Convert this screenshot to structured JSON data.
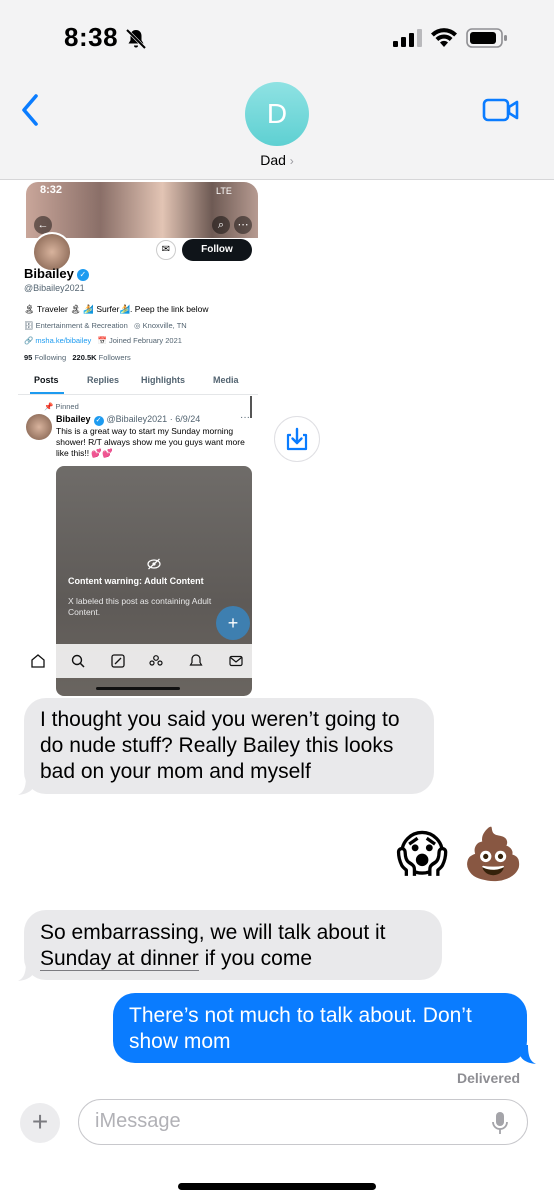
{
  "status_bar": {
    "time": "8:38",
    "icons": [
      "bell-slash-icon",
      "cellular-signal-icon",
      "wifi-icon",
      "battery-icon"
    ]
  },
  "nav": {
    "back_icon": "chevron-left-icon",
    "avatar_initial": "D",
    "contact_name": "Dad",
    "contact_chevron": "›",
    "video_icon": "video-camera-icon",
    "accent": "#0a7cff"
  },
  "shared_image": {
    "banner_time": "8:32",
    "banner_network": "LTE",
    "follow_label": "Follow",
    "name": "Bibailey",
    "handle": "@Bibailey2021",
    "bio": "🏝 Traveler 🏝 🏄 Surfer🏄. Peep the link below",
    "meta_category": "🗄 Entertainment & Recreation",
    "meta_location": "◎ Knoxville, TN",
    "meta_link": "🔗 msha.ke/bibailey",
    "meta_joined": "📅 Joined February 2021",
    "following_count": "95",
    "following_label": "Following",
    "followers_count": "220.5K",
    "followers_label": "Followers",
    "tabs": [
      "Posts",
      "Replies",
      "Highlights",
      "Media"
    ],
    "pinned_label": "📌 Pinned",
    "tweet_name": "Bibailey",
    "tweet_handle_date": "@Bibailey2021 · 6/9/24",
    "tweet_more": "···",
    "tweet_text": "This is a great way to start my Sunday morning shower! R/T always show me you guys want more like this!! 💕💕",
    "content_warning_title": "Content warning: Adult Content",
    "content_warning_desc": "X labeled this post as containing Adult Content.",
    "fab_label": "+"
  },
  "save_button_icon": "download-icon",
  "messages": {
    "received_1": "I thought you said you weren’t going to do nude stuff? Really Bailey this looks bad on your mom and myself",
    "sent_emojis": "😱 💩",
    "received_2_prefix": "So embarrassing, we will talk about it ",
    "received_2_link": "Sunday at dinner",
    "received_2_suffix": " if you come",
    "sent_1": "There’s not much to talk about. Don’t show mom",
    "delivered": "Delivered",
    "received_color": "#e9e9eb",
    "sent_color": "#0a7cff"
  },
  "input_bar": {
    "plus": "+",
    "placeholder": "iMessage",
    "mic_icon": "microphone-icon"
  }
}
